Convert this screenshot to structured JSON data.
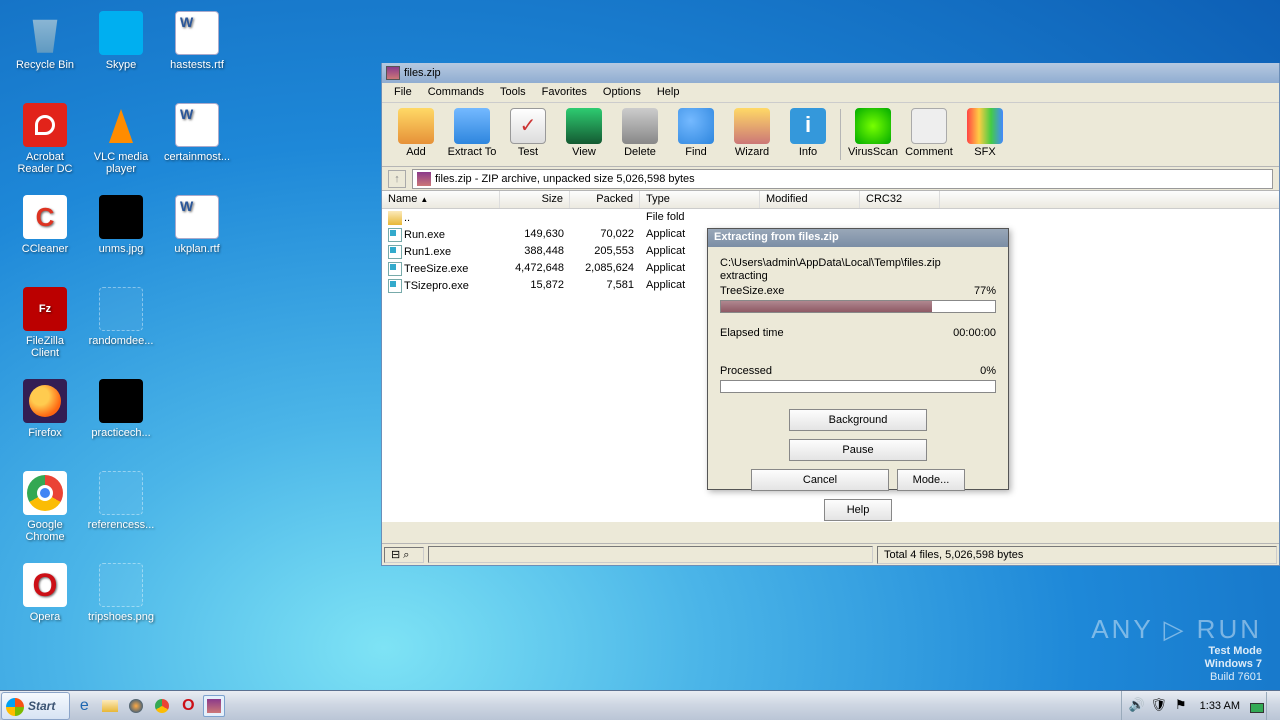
{
  "desktop": {
    "col1": [
      {
        "label": "Recycle Bin",
        "cls": "bin"
      },
      {
        "label": "Acrobat Reader DC",
        "cls": "adobe"
      },
      {
        "label": "CCleaner",
        "cls": "ccl"
      },
      {
        "label": "FileZilla Client",
        "cls": "fz"
      },
      {
        "label": "Firefox",
        "cls": "ff"
      },
      {
        "label": "Google Chrome",
        "cls": "chrome"
      },
      {
        "label": "Opera",
        "cls": "opera"
      }
    ],
    "col2": [
      {
        "label": "Skype",
        "cls": "skype"
      },
      {
        "label": "VLC media player",
        "cls": "vlc"
      },
      {
        "label": "unms.jpg",
        "cls": "blk"
      },
      {
        "label": "randomdee...",
        "cls": "png"
      },
      {
        "label": "practicech...",
        "cls": "blk"
      },
      {
        "label": "referencess...",
        "cls": "png"
      },
      {
        "label": "tripshoes.png",
        "cls": "png"
      }
    ],
    "col3": [
      {
        "label": "hastests.rtf",
        "cls": "word"
      },
      {
        "label": "certainmost...",
        "cls": "word"
      },
      {
        "label": "ukplan.rtf",
        "cls": "word"
      }
    ]
  },
  "winrar": {
    "title": "files.zip",
    "menu": [
      "File",
      "Commands",
      "Tools",
      "Favorites",
      "Options",
      "Help"
    ],
    "toolbar": [
      {
        "label": "Add",
        "cls": "ic-add"
      },
      {
        "label": "Extract To",
        "cls": "ic-ext"
      },
      {
        "label": "Test",
        "cls": "ic-test"
      },
      {
        "label": "View",
        "cls": "ic-view"
      },
      {
        "label": "Delete",
        "cls": "ic-del"
      },
      {
        "label": "Find",
        "cls": "ic-find"
      },
      {
        "label": "Wizard",
        "cls": "ic-wiz"
      },
      {
        "label": "Info",
        "cls": "ic-info"
      },
      {
        "sep": true
      },
      {
        "label": "VirusScan",
        "cls": "ic-scan"
      },
      {
        "label": "Comment",
        "cls": "ic-cmt"
      },
      {
        "label": "SFX",
        "cls": "ic-sfx"
      }
    ],
    "path": "files.zip - ZIP archive, unpacked size 5,026,598 bytes",
    "columns": [
      "Name",
      "Size",
      "Packed",
      "Type",
      "Modified",
      "CRC32"
    ],
    "rows": [
      {
        "name": "..",
        "size": "",
        "packed": "",
        "type": "File fold",
        "fic": "fold"
      },
      {
        "name": "Run.exe",
        "size": "149,630",
        "packed": "70,022",
        "type": "Applicat",
        "fic": "exe"
      },
      {
        "name": "Run1.exe",
        "size": "388,448",
        "packed": "205,553",
        "type": "Applicat",
        "fic": "exe"
      },
      {
        "name": "TreeSize.exe",
        "size": "4,472,648",
        "packed": "2,085,624",
        "type": "Applicat",
        "fic": "exe"
      },
      {
        "name": "TSizepro.exe",
        "size": "15,872",
        "packed": "7,581",
        "type": "Applicat",
        "fic": "exe"
      }
    ],
    "status": "Total 4 files, 5,026,598 bytes"
  },
  "dialog": {
    "title": "Extracting from files.zip",
    "path": "C:\\Users\\admin\\AppData\\Local\\Temp\\files.zip",
    "action": "extracting",
    "file": "TreeSize.exe",
    "pct1": "77%",
    "pct1v": 77,
    "elapsed_lbl": "Elapsed time",
    "elapsed": "00:00:00",
    "proc_lbl": "Processed",
    "proc": "0%",
    "proc_v": 0,
    "btns": {
      "bg": "Background",
      "pause": "Pause",
      "cancel": "Cancel",
      "mode": "Mode...",
      "help": "Help"
    }
  },
  "taskbar": {
    "start": "Start",
    "clock": "1:33 AM"
  },
  "watermark": {
    "brand": "ANY ▷ RUN",
    "l1": "Test Mode",
    "l2": "Windows 7",
    "l3": "Build 7601"
  }
}
